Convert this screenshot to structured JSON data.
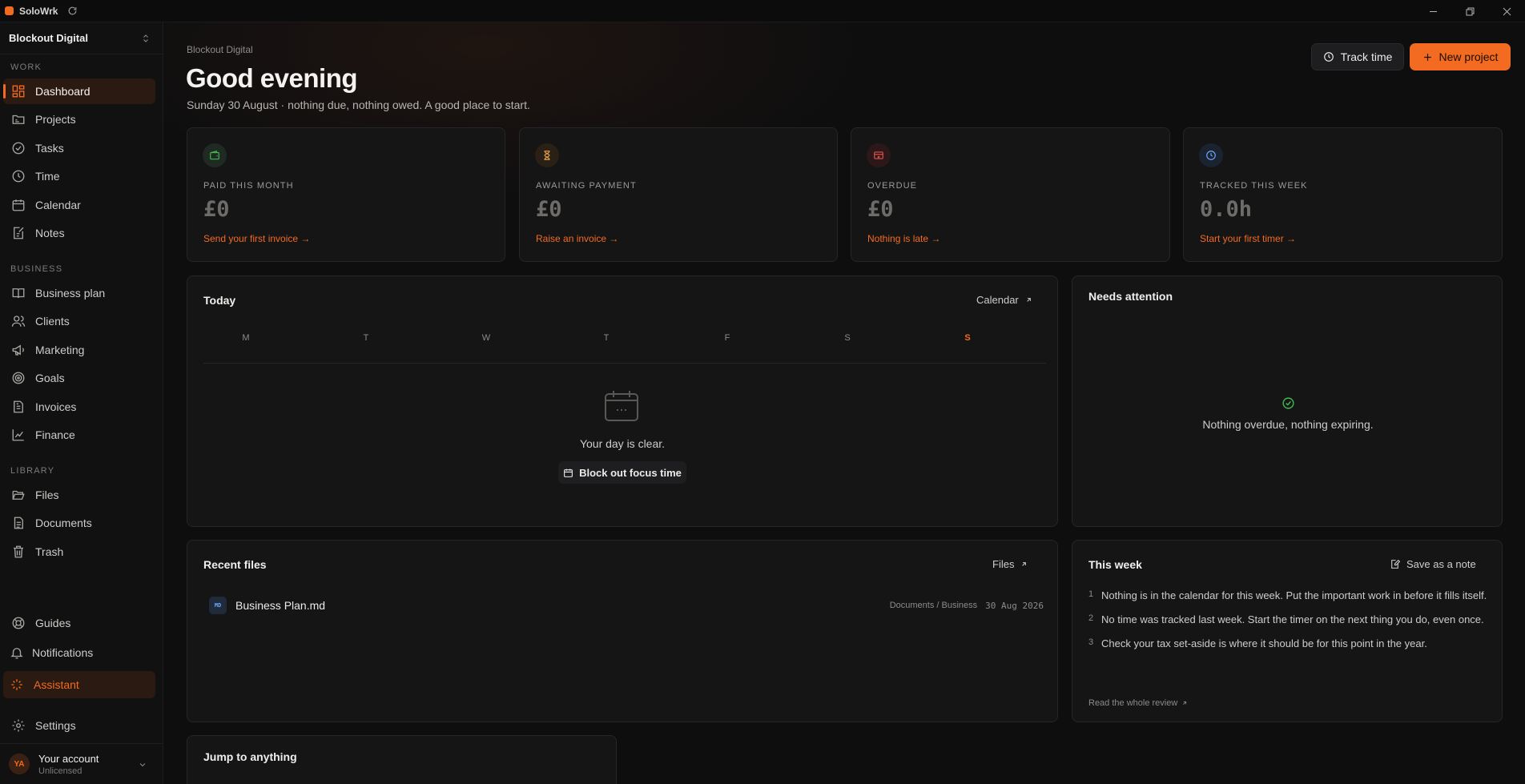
{
  "titlebar": {
    "app_name": "SoloWrk"
  },
  "sidebar": {
    "workspace": "Blockout Digital",
    "sections": {
      "work": "WORK",
      "business": "BUSINESS",
      "library": "LIBRARY"
    },
    "items": {
      "dashboard": "Dashboard",
      "projects": "Projects",
      "tasks": "Tasks",
      "time": "Time",
      "calendar": "Calendar",
      "notes": "Notes",
      "business_plan": "Business plan",
      "clients": "Clients",
      "marketing": "Marketing",
      "goals": "Goals",
      "invoices": "Invoices",
      "finance": "Finance",
      "files": "Files",
      "documents": "Documents",
      "trash": "Trash",
      "guides": "Guides",
      "notifications": "Notifications",
      "assistant": "Assistant",
      "settings": "Settings"
    },
    "account": {
      "initials": "YA",
      "name": "Your account",
      "status": "Unlicensed"
    }
  },
  "header": {
    "breadcrumb": "Blockout Digital",
    "greeting": "Good evening",
    "subline": "Sunday 30 August · nothing due, nothing owed. A good place to start.",
    "track_time": "Track time",
    "new_project": "New project"
  },
  "stats": {
    "paid": {
      "label": "PAID THIS MONTH",
      "value": "£0",
      "link": "Send your first invoice →"
    },
    "awaiting": {
      "label": "AWAITING PAYMENT",
      "value": "£0",
      "link": "Raise an invoice →"
    },
    "overdue": {
      "label": "OVERDUE",
      "value": "£0",
      "link": "Nothing is late →"
    },
    "tracked": {
      "label": "TRACKED THIS WEEK",
      "value": "0.0h",
      "link": "Start your first timer →"
    }
  },
  "today": {
    "title": "Today",
    "calendar_link": "Calendar",
    "weekdays": [
      "M",
      "T",
      "W",
      "T",
      "F",
      "S",
      "S"
    ],
    "empty_text": "Your day is clear.",
    "focus_button": "Block out focus time"
  },
  "attention": {
    "title": "Needs attention",
    "empty_text": "Nothing overdue, nothing expiring."
  },
  "recent_files": {
    "title": "Recent files",
    "files_link": "Files",
    "items": [
      {
        "badge": "MD",
        "name": "Business Plan.md",
        "path": "Documents / Business",
        "date": "30 Aug 2026"
      }
    ]
  },
  "this_week": {
    "title": "This week",
    "save_note": "Save as a note",
    "items": [
      {
        "num": "1",
        "text": "Nothing is in the calendar for this week. Put the important work in before it fills itself."
      },
      {
        "num": "2",
        "text": "No time was tracked last week. Start the timer on the next thing you do, even once."
      },
      {
        "num": "3",
        "text": "Check your tax set-aside is where it should be for this point in the year."
      }
    ],
    "review_link": "Read the whole review"
  },
  "jump": {
    "title": "Jump to anything"
  }
}
